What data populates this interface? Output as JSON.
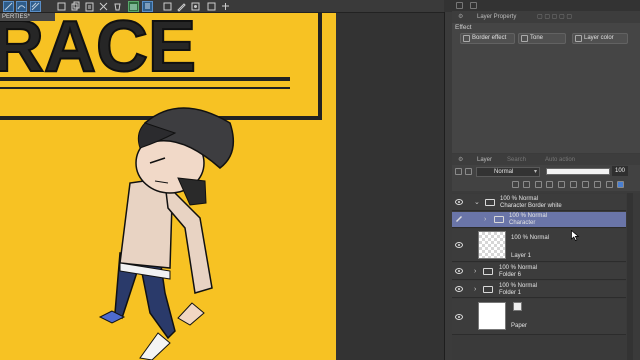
{
  "document_tab": "PERTIES*",
  "canvas": {
    "sign_text": "RACE",
    "background_color": "#f7c223"
  },
  "toolbar_icons": [
    "line-tool-icon",
    "curve-tool-icon",
    "grid-icon",
    "transform-icon",
    "copy-icon",
    "paste-icon",
    "clear-icon",
    "fill-icon",
    "layers-icon",
    "erase-icon",
    "pen-icon",
    "image-icon",
    "eyedropper-icon",
    "fill-icon",
    "text-icon"
  ],
  "layer_property": {
    "title": "Layer Property",
    "effect_label": "Effect",
    "buttons": [
      "Border effect",
      "Tone",
      "Layer color"
    ]
  },
  "layer_panel": {
    "tabs": [
      "Layer",
      "Search",
      "Auto action"
    ],
    "blend_mode": "Normal",
    "opacity": "100",
    "opacity_fraction": 1.0,
    "layers": [
      {
        "mode": "100 % Normal",
        "name": "Character Border white",
        "type": "folder",
        "expanded": true
      },
      {
        "mode": "100 % Normal",
        "name": "Character",
        "type": "folder",
        "selected": true
      },
      {
        "mode": "100 % Normal",
        "name": "Layer 1",
        "type": "raster"
      },
      {
        "mode": "100 % Normal",
        "name": "Folder 6",
        "type": "folder"
      },
      {
        "mode": "100 % Normal",
        "name": "Folder 1",
        "type": "folder"
      },
      {
        "mode": "",
        "name": "Paper",
        "type": "paper"
      }
    ]
  },
  "colors": {
    "selection": "#6a75a8",
    "panel": "#3b3b3b",
    "accent": "#f7c223"
  }
}
